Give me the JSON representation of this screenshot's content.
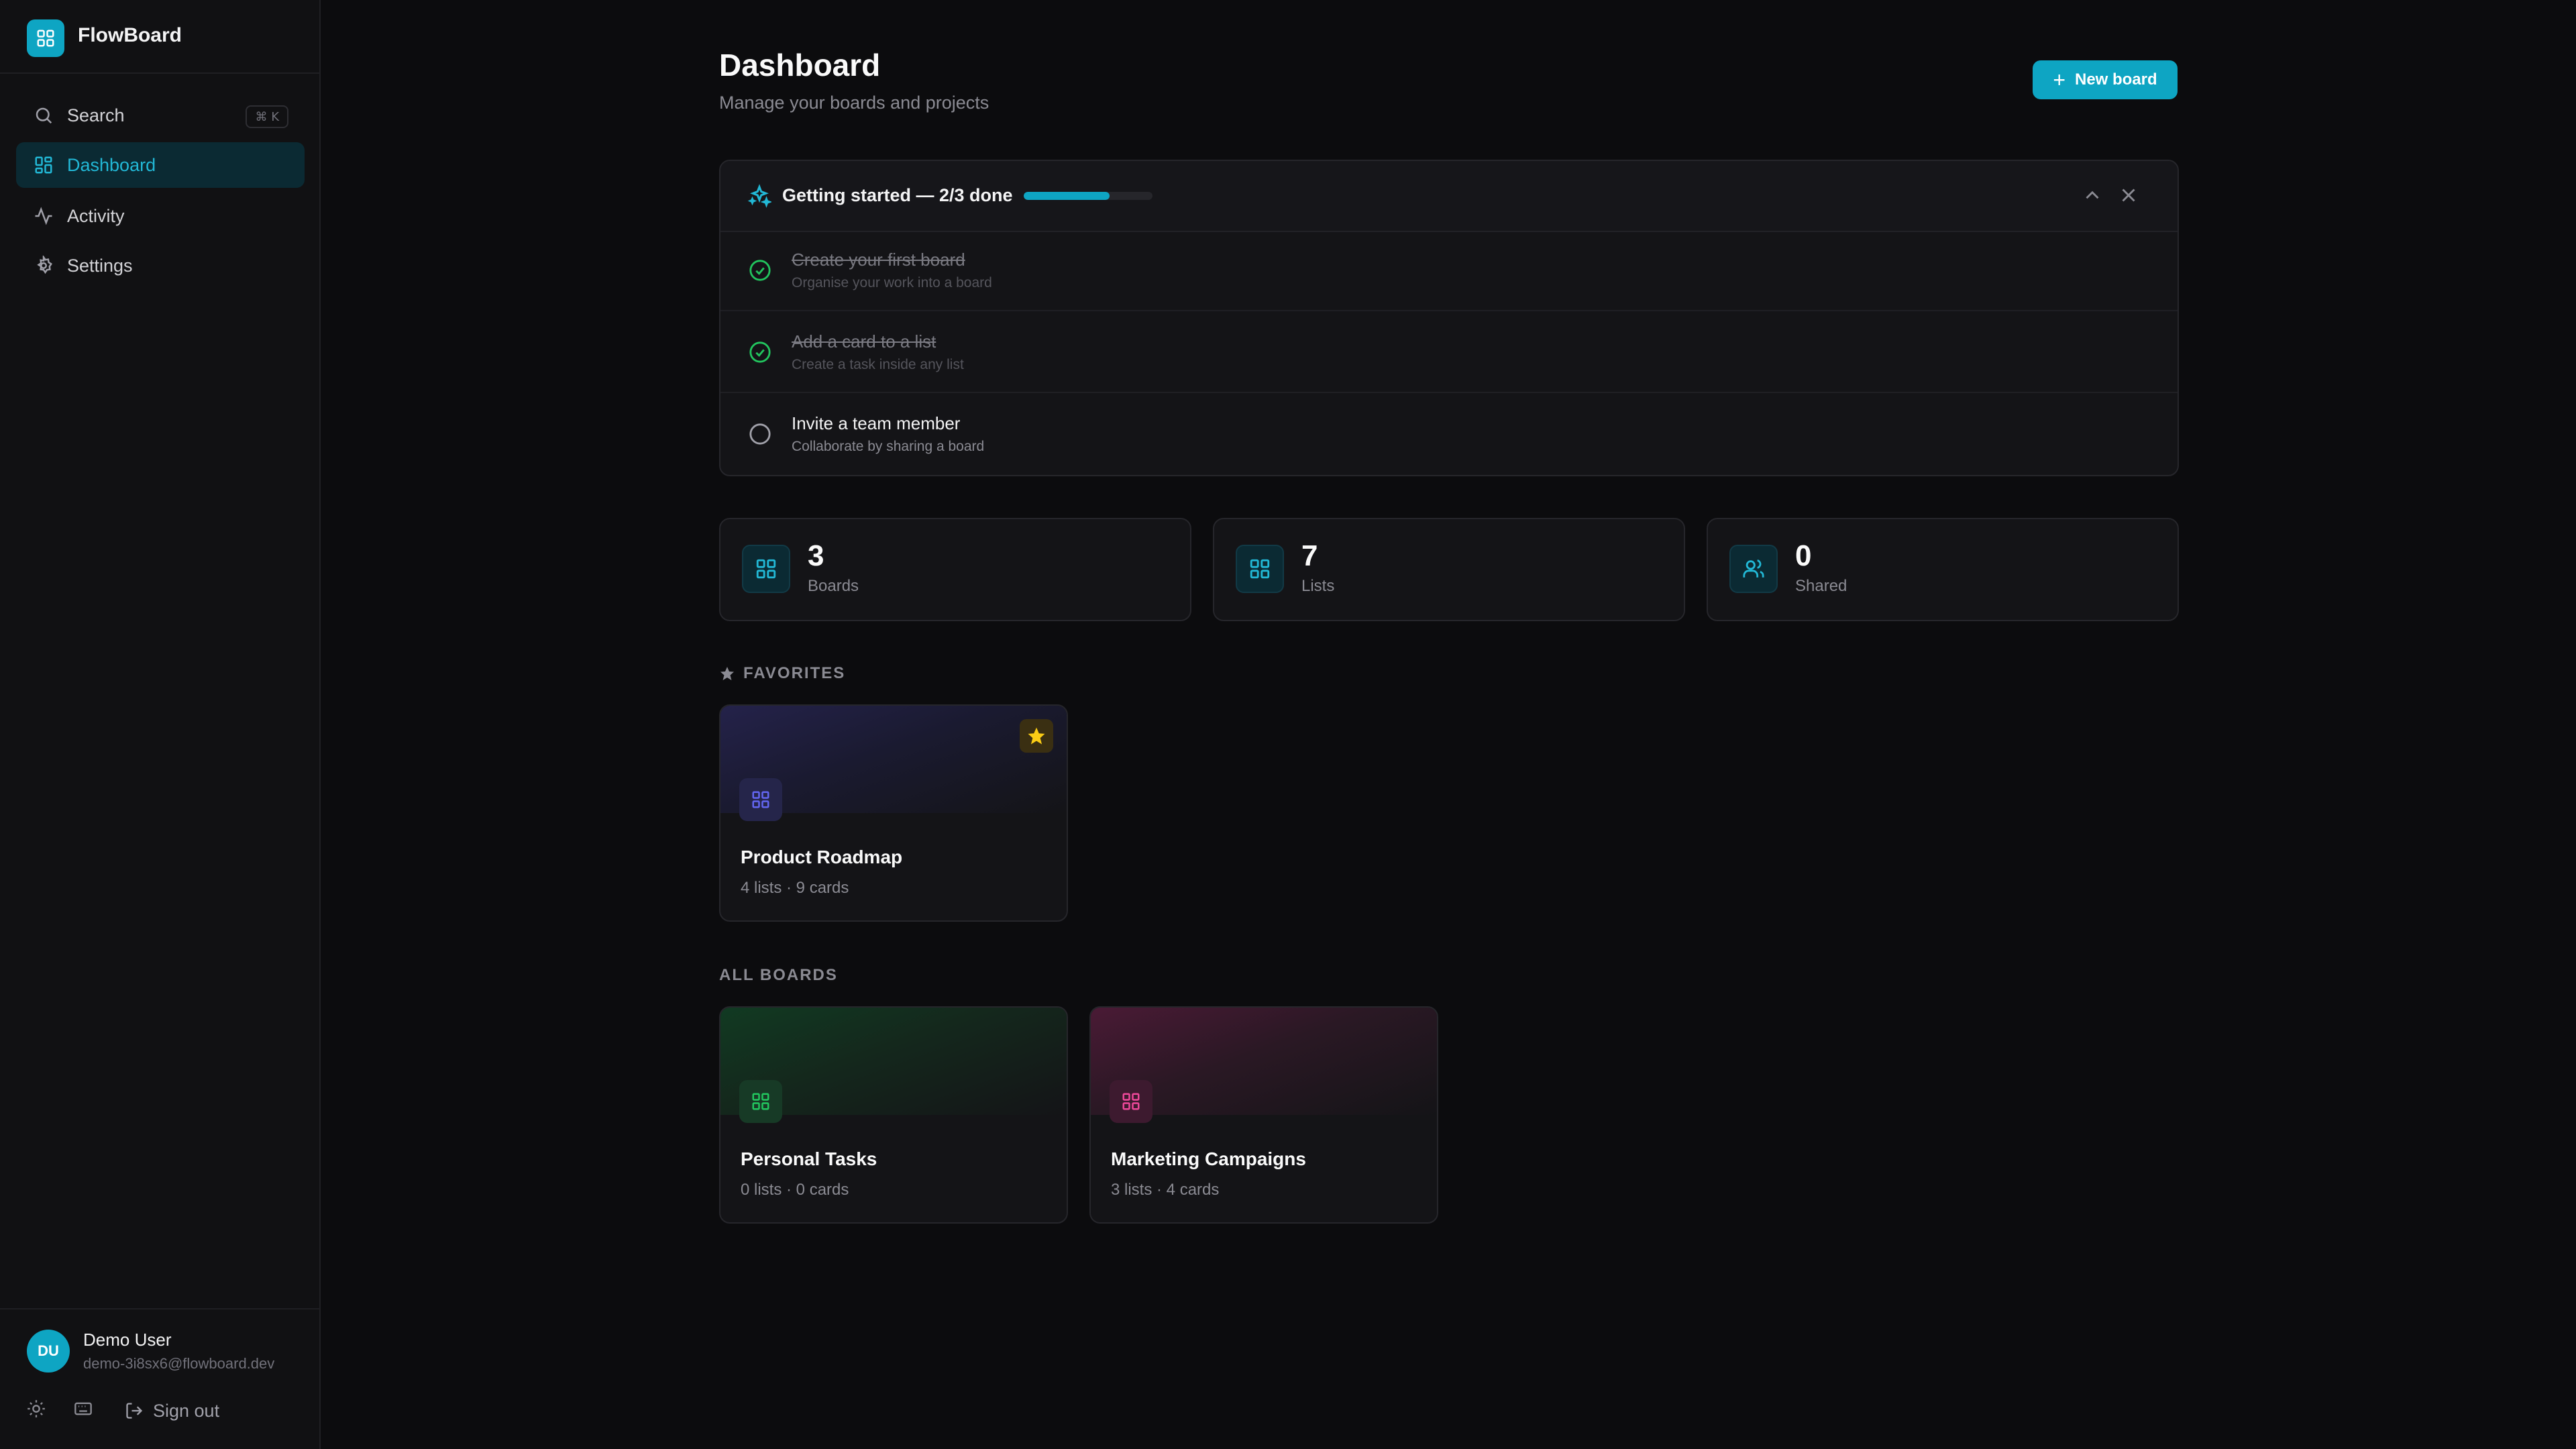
{
  "app": {
    "name": "FlowBoard"
  },
  "sidebar": {
    "search": {
      "label": "Search",
      "shortcut": "⌘ K"
    },
    "items": [
      {
        "label": "Dashboard",
        "icon": "dashboard-icon",
        "active": true
      },
      {
        "label": "Activity",
        "icon": "activity-icon",
        "active": false
      },
      {
        "label": "Settings",
        "icon": "gear-icon",
        "active": false
      }
    ],
    "user": {
      "initials": "DU",
      "name": "Demo User",
      "email": "demo-3i8sx6@flowboard.dev"
    },
    "footer": {
      "sign_out": "Sign out",
      "icons": [
        "sun-icon",
        "keyboard-icon",
        "sign-out-icon"
      ]
    }
  },
  "header": {
    "title": "Dashboard",
    "subtitle": "Manage your boards and projects",
    "new_board_label": "New board"
  },
  "getting_started": {
    "title": "Getting started — 2/3 done",
    "progress_fraction": 0.667,
    "tasks": [
      {
        "title": "Create your first board",
        "desc": "Organise your work into a board",
        "done": true
      },
      {
        "title": "Add a card to a list",
        "desc": "Create a task inside any list",
        "done": true
      },
      {
        "title": "Invite a team member",
        "desc": "Collaborate by sharing a board",
        "done": false
      }
    ]
  },
  "stats": [
    {
      "value": "3",
      "label": "Boards",
      "icon": "board-icon"
    },
    {
      "value": "7",
      "label": "Lists",
      "icon": "board-icon"
    },
    {
      "value": "0",
      "label": "Shared",
      "icon": "users-icon"
    }
  ],
  "favorites": {
    "heading": "FAVORITES",
    "boards": [
      {
        "name": "Product Roadmap",
        "meta": "4 lists · 9 cards",
        "color": "#6366f1",
        "favorite": true
      }
    ]
  },
  "all_boards": {
    "heading": "ALL BOARDS",
    "boards": [
      {
        "name": "Personal Tasks",
        "meta": "0 lists · 0 cards",
        "color": "#22c55e",
        "favorite": false
      },
      {
        "name": "Marketing Campaigns",
        "meta": "3 lists · 4 cards",
        "color": "#ec4899",
        "favorite": false
      }
    ]
  },
  "colors": {
    "accent": "#0ea5c3",
    "done": "#22c55e",
    "star": "#facc15"
  }
}
